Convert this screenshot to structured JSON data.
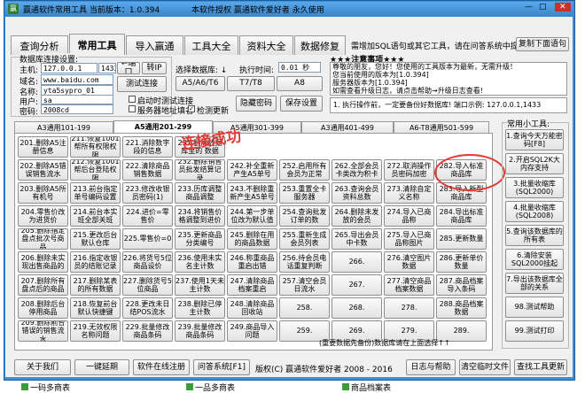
{
  "window": {
    "title": "赢通软件常用工具 当前版本：1.0.394",
    "auth": "本软件授权 赢通软件爱好者 永久使用",
    "controls": [
      "—",
      "□",
      "✕"
    ]
  },
  "tabs": [
    "查询分析",
    "常用工具",
    "导入赢通",
    "工具大全",
    "资料大全",
    "数据修复"
  ],
  "header": {
    "notice": "需增加SQL语句或其它工具，请在问答系统中提交!",
    "copy_btn": "复制下面语句"
  },
  "db": {
    "group": "数据库连接设置:",
    "host_label": "主机:",
    "host": "127.0.0.1",
    "port": "1433",
    "domain_label": "域名:",
    "domain": "www.baidu.com",
    "dbname_label": "名称:",
    "dbname": "yta5sypro_01",
    "user_label": "用户:",
    "user": "sa",
    "pwd_label": "密码:",
    "pwd": "2008cd",
    "port_btn": "←端口",
    "convert_btn": "转IP",
    "test_btn": "测试连接",
    "select_label": "选择数据库: ↓",
    "exec_label": "执行时间:",
    "exec_time": "0.01 秒",
    "versions": [
      "A5/A6/T6",
      "T7/T8",
      "A8"
    ],
    "opts": [
      "启动时测试连接",
      "服务器地址填名",
      "检测更新"
    ],
    "hide_pwd": "隐藏密码",
    "save": "保存设置",
    "success": "连接成功"
  },
  "notes": {
    "title": "★★★注意事项★★★",
    "lines": [
      "尊敬的朋友，您好！您使用的工具版本为最新，无需升级！",
      "您当前使用的版本为[1.0.394]",
      "服务器版本为[1.0.394]",
      "如需查看升级日志，请点击帮助→升级日志查看!"
    ],
    "step": "1. 执行操作前，一定要备份好数据库! 端口示例: 127.0.0.1,1433"
  },
  "subtabs": [
    "A3通用101-199",
    "A5通用201-299",
    "A5通用301-399",
    "A3通用401-499",
    "A6-T8通用501-599"
  ],
  "grid": [
    [
      "201.删除A5注册信息",
      "211.恢复1001帮所有权限权限",
      "221.消除数字段的信息",
      "231.删除数据库里的 数据"
    ],
    [
      "202.删除A5错误销售流水",
      "212.恢复1001帮后台登陆权限",
      "222.清除商品销售数据",
      "232.删除销售员批发结算记录",
      "242.补全重新产生A5单号",
      "252.启用所有会员为正常",
      "262.全部会员卡类改为积卡",
      "272.取消操作员密码加密",
      "282.导入标准商品库"
    ],
    [
      "203.删除A5所有机号",
      "213.前台指定单号编码设置",
      "223.修改收银员密码(1)",
      "233.历库调整商品调整",
      "243.不删除重新产生A5单号",
      "253.重置全卡服务器",
      "263.查询会员资料总数",
      "273.清除自定义名称",
      "283.导入新型商品库"
    ],
    [
      "204.零售价改为进货价",
      "214.前台本实班全部关班",
      "224.进价=零售价",
      "234.将销售价格调整到进价",
      "244.第一步单位改为默认值",
      "254.查询批发订单的数",
      "264.删除未发放的会员",
      "274.导入已商品称",
      "284.导出标准商品库"
    ],
    [
      "205.删除指定盘点批次号商品",
      "215.更改后台默认仓库",
      "225.零售价=0",
      "235.更新商品分类编号",
      "245.删除在用的商品数据",
      "255.重新生成会员列表",
      "265.导出会员中卡数",
      "275.导入已商品称图片",
      "285.更新数量"
    ],
    [
      "206.删除未实现出售商品的",
      "216.指定收银员的结账记录",
      "226.将货号5位商品设价",
      "236.使用未实名主计数",
      "246.称重商品重启出错",
      "256.持会员电话重复判断",
      "266.",
      "276.清空图片数据",
      "286.更新单价数量"
    ],
    [
      "207.删除所有盘点后的商品",
      "217.删除某表的所有数据",
      "227.删除货号5位商品",
      "237.使用1天未主计数",
      "247.清除商品档案重启",
      "257.清空会员日流水",
      "267.",
      "277.清空商品档案数据",
      "287.商品档案导入条码"
    ],
    [
      "208.删除后台停用商品",
      "218.恢复前台默认快捷键",
      "228.更改未日结POS流水",
      "238.删除已停主计数",
      "248.清除商品回收站",
      "258.",
      "268.",
      "278.",
      "288.商品档案数据"
    ],
    [
      "209.删除前台错误的销售流水",
      "219.无效权限名称问题",
      "229.批量修改商品条码",
      "239.批量修改商品条码",
      "249.商品导入问题",
      "259.",
      "269.",
      "279.",
      "289."
    ]
  ],
  "side": {
    "title": "常用小工具:",
    "items": [
      "1.查询今天万能密码[F8]",
      "2.开启SQL2K大内存支持",
      "3.批量收缩库(SQL2000)",
      "4.批量收缩库(SQL2008)",
      "5.查询该数据库的所有表",
      "6.清除安装SQL2000挂起",
      "7.导出该数据库全部的关系",
      "98.测试帮助",
      "99.测试打印"
    ]
  },
  "footer_note": "(重要数据先备份)数据库请在上面选择↑↑",
  "bottom": [
    "关于我们",
    "一键延期",
    "软件在线注册",
    "问答系统[F1]",
    "版权(C) 赢通软件爱好者 2008 - 2016",
    "日志与帮助",
    "清空临时文件",
    "查找工具更新"
  ],
  "taskbar": [
    "一码多商表",
    "一品多商表",
    "商品档案表"
  ]
}
